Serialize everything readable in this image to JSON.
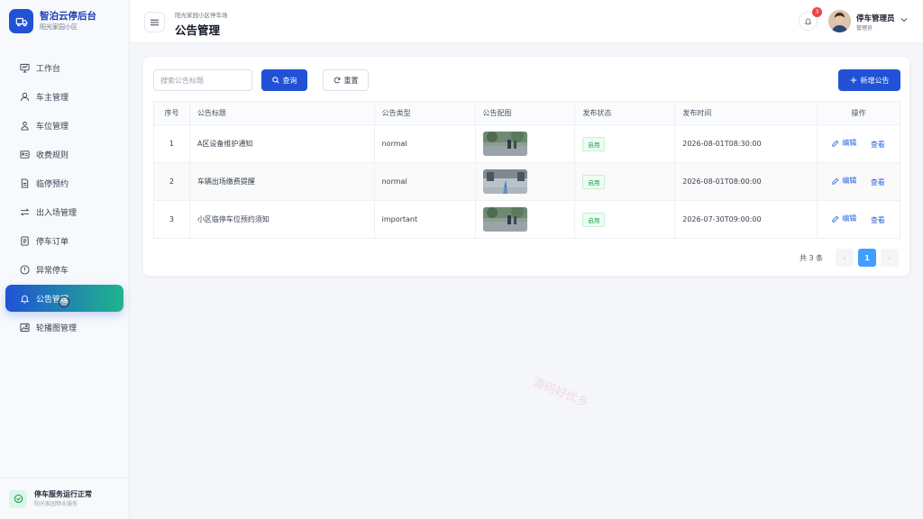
{
  "brand": {
    "name": "智泊云停后台",
    "community": "阳光家园小区"
  },
  "sidebar": {
    "items": [
      {
        "label": "工作台",
        "icon": "monitor-icon"
      },
      {
        "label": "车主管理",
        "icon": "user-icon"
      },
      {
        "label": "车位管理",
        "icon": "users-icon"
      },
      {
        "label": "收费规则",
        "icon": "id-card-icon"
      },
      {
        "label": "临停预约",
        "icon": "document-icon"
      },
      {
        "label": "出入场管理",
        "icon": "swap-icon"
      },
      {
        "label": "停车订单",
        "icon": "list-icon"
      },
      {
        "label": "异常停车",
        "icon": "warning-icon"
      },
      {
        "label": "公告管理",
        "icon": "bell-icon",
        "active": true
      },
      {
        "label": "轮播图管理",
        "icon": "image-icon"
      }
    ],
    "status": {
      "title": "停车服务运行正常",
      "sub": "阳光家园物业服务"
    }
  },
  "header": {
    "breadcrumb": "阳光家园小区停车场",
    "title": "公告管理",
    "notification_count": "3",
    "user_name": "停车管理员",
    "user_role": "管理员"
  },
  "toolbar": {
    "search_placeholder": "搜索公告标题",
    "query_label": "查询",
    "reset_label": "重置",
    "add_label": "新增公告"
  },
  "table": {
    "headers": [
      "序号",
      "公告标题",
      "公告类型",
      "公告配图",
      "发布状态",
      "发布时间",
      "操作"
    ],
    "rows": [
      {
        "no": "1",
        "title": "A区设备维护通知",
        "type": "normal",
        "status": "启用",
        "time": "2026-08-01T08:30:00",
        "edit": "编辑",
        "view": "查看"
      },
      {
        "no": "2",
        "title": "车辆出场缴费提醒",
        "type": "normal",
        "status": "启用",
        "time": "2026-08-01T08:00:00",
        "edit": "编辑",
        "view": "查看"
      },
      {
        "no": "3",
        "title": "小区临停车位预约须知",
        "type": "important",
        "status": "启用",
        "time": "2026-07-30T09:00:00",
        "edit": "编辑",
        "view": "查看"
      }
    ]
  },
  "pagination": {
    "total_text": "共 3 条",
    "current_page": "1",
    "prev": "‹",
    "next": "›"
  },
  "watermark": "源码好优多",
  "colors": {
    "primary": "#2152d6",
    "accent": "#1fb58a",
    "page_active": "#409eff",
    "status_green": "#16a34a"
  }
}
